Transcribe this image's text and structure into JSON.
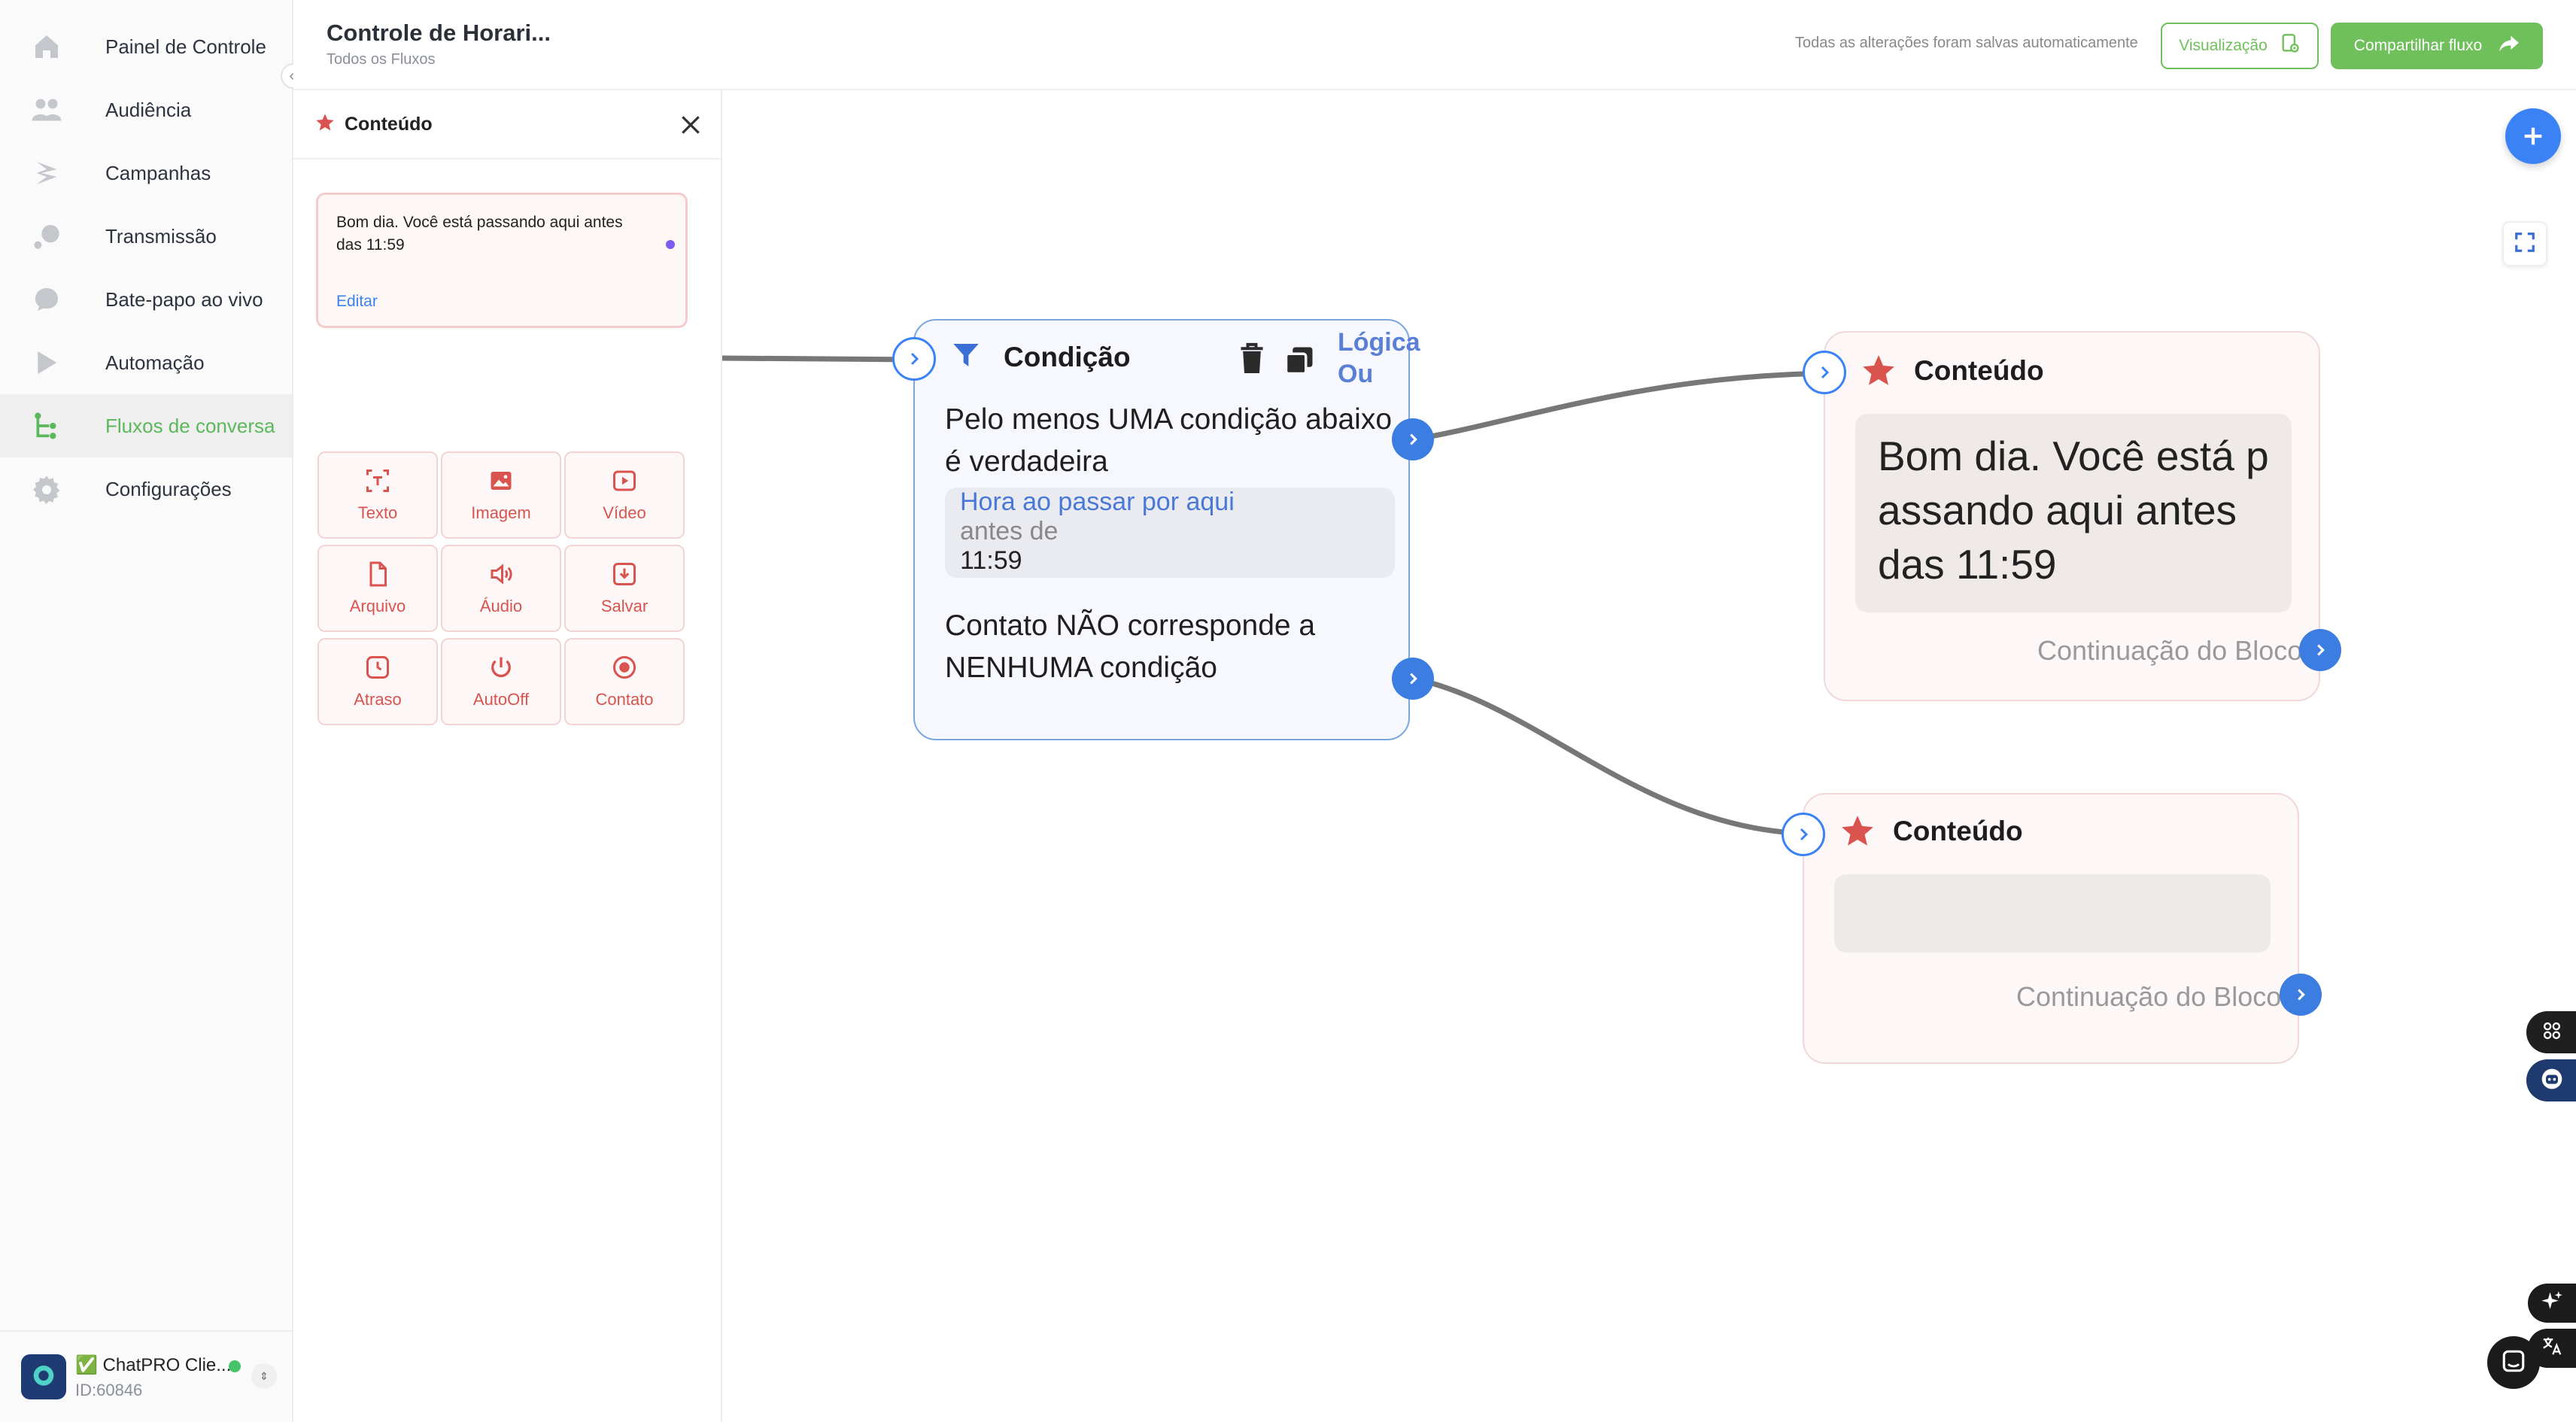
{
  "nav": {
    "items": [
      {
        "label": "Painel de Controle",
        "icon": "home-icon"
      },
      {
        "label": "Audiência",
        "icon": "users-icon"
      },
      {
        "label": "Campanhas",
        "icon": "campaign-icon"
      },
      {
        "label": "Transmissão",
        "icon": "broadcast-icon"
      },
      {
        "label": "Bate-papo ao vivo",
        "icon": "chat-icon"
      },
      {
        "label": "Automação",
        "icon": "automation-icon"
      },
      {
        "label": "Fluxos de conversa",
        "icon": "flow-icon",
        "active": true
      },
      {
        "label": "Configurações",
        "icon": "gear-icon"
      }
    ],
    "account": {
      "name": "✅ ChatPRO Clie...",
      "id": "ID:60846",
      "status": "online"
    }
  },
  "topbar": {
    "title": "Controle de Horari...",
    "breadcrumb": "Todos os Fluxos",
    "autosave": "Todas as alterações foram salvas automaticamente",
    "preview_label": "Visualização",
    "share_label": "Compartilhar fluxo"
  },
  "panel": {
    "title": "Conteúdo",
    "message": "Bom dia. Você está passando aqui antes das 11:59",
    "edit_label": "Editar",
    "tools": [
      "Texto",
      "Imagem",
      "Vídeo",
      "Arquivo",
      "Áudio",
      "Salvar",
      "Atraso",
      "AutoOff",
      "Contato"
    ]
  },
  "canvas": {
    "condition": {
      "title": "Condição",
      "logic_line1": "Lógica",
      "logic_line2": "Ou",
      "true_text": "Pelo menos UMA condição abaixo é verdadeira",
      "rule_field": "Hora ao passar por aqui",
      "rule_op": "antes de",
      "rule_value": "11:59",
      "false_text": "Contato NÃO corresponde a NENHUMA condição"
    },
    "content1": {
      "title": "Conteúdo",
      "message": "Bom dia. Você está passando aqui antes das 11:59",
      "continue_label": "Continuação do Bloco"
    },
    "content2": {
      "title": "Conteúdo",
      "message": "",
      "continue_label": "Continuação do Bloco"
    }
  },
  "colors": {
    "accent_green": "#6fbf5a",
    "accent_blue": "#3b82f6",
    "content_red": "#d9534f"
  }
}
